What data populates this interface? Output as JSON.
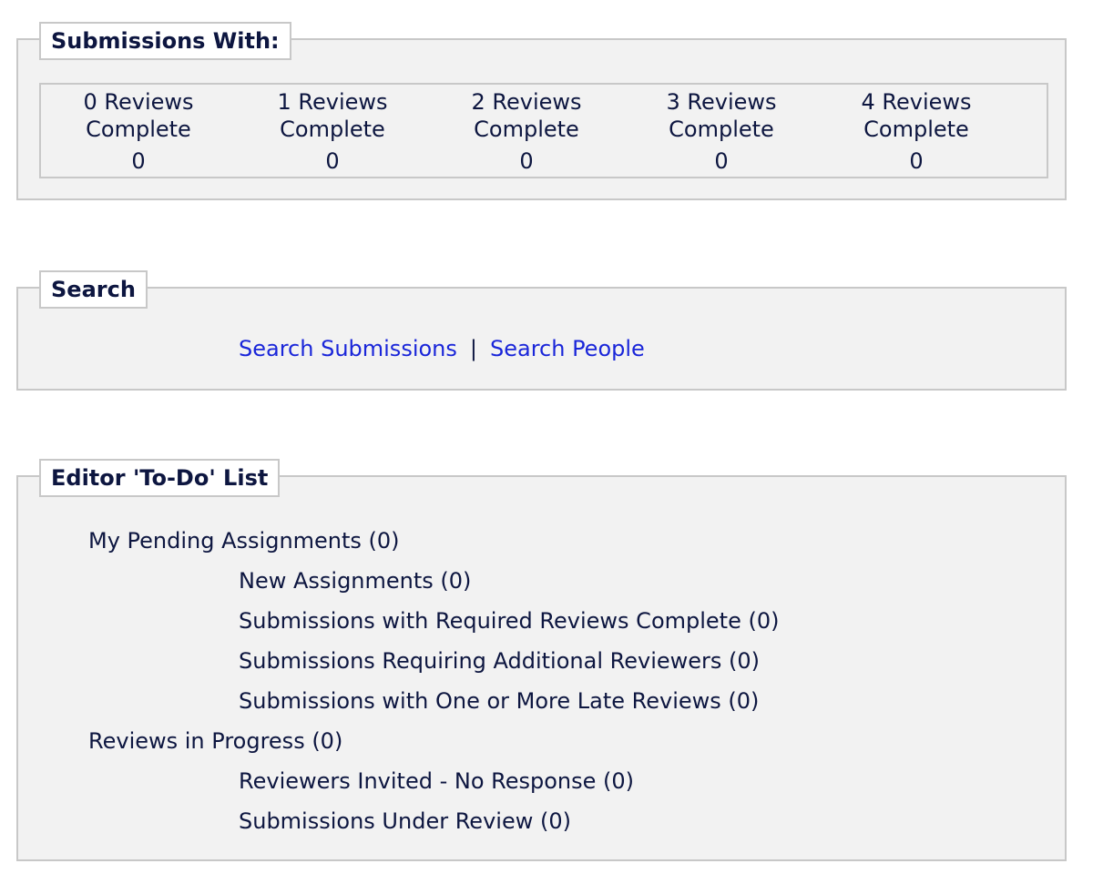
{
  "submissions_panel": {
    "legend": "Submissions With:",
    "reviews": [
      {
        "label_line1": "0 Reviews",
        "label_line2": "Complete",
        "count": "0"
      },
      {
        "label_line1": "1 Reviews",
        "label_line2": "Complete",
        "count": "0"
      },
      {
        "label_line1": "2 Reviews",
        "label_line2": "Complete",
        "count": "0"
      },
      {
        "label_line1": "3 Reviews",
        "label_line2": "Complete",
        "count": "0"
      },
      {
        "label_line1": "4 Reviews",
        "label_line2": "Complete",
        "count": "0"
      }
    ]
  },
  "search_panel": {
    "legend": "Search",
    "search_submissions": "Search Submissions",
    "separator": "|",
    "search_people": "Search People"
  },
  "todo_panel": {
    "legend": "Editor 'To-Do' List",
    "items": [
      {
        "label": "My Pending Assignments (0)"
      },
      {
        "label": "New Assignments (0)"
      },
      {
        "label": "Submissions with Required Reviews Complete (0)"
      },
      {
        "label": "Submissions Requiring Additional Reviewers (0)"
      },
      {
        "label": "Submissions with One or More Late Reviews (0)"
      },
      {
        "label": "Reviews in Progress (0)"
      },
      {
        "label": "Reviewers Invited - No Response (0)"
      },
      {
        "label": "Submissions Under Review (0)"
      }
    ]
  },
  "colors": {
    "panel_background": "#f2f2f2",
    "border": "#c8c8c8",
    "text": "#0d1640",
    "link": "#1a26d9"
  }
}
